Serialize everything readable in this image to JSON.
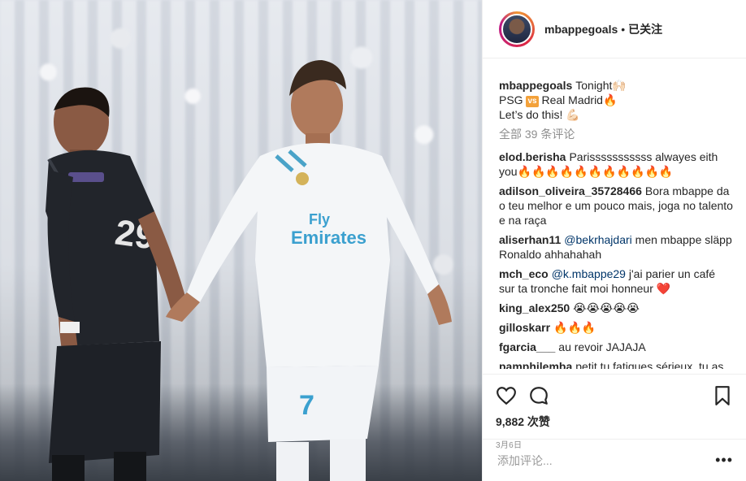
{
  "photo": {
    "alt": "Two football players holding hands on a pitch"
  },
  "header": {
    "username": "mbappegoals",
    "dot": "•",
    "follow_status": "已关注"
  },
  "caption": {
    "username": "mbappegoals",
    "line1": "Tonight🙌🏻",
    "line2_a": "PSG ",
    "vs": "vs",
    "line2_b": " Real Madrid🔥",
    "line3": "Let’s do this! 💪🏻"
  },
  "view_all": "全部 39 条评论",
  "comments": [
    {
      "user": "elod.berisha",
      "text": "Parisssssssssss alwayes eith you🔥🔥🔥🔥🔥🔥🔥🔥🔥🔥🔥"
    },
    {
      "user": "adilson_oliveira_35728466",
      "text": "Bora mbappe da o teu melhor e um pouco mais, joga no talento e na raça"
    },
    {
      "user": "aliserhan11",
      "mention": "@bekrhajdari",
      "text": " men mbappe släpp Ronaldo ahhahahah"
    },
    {
      "user": "mch_eco",
      "mention": "@k.mbappe29",
      "text": " j'ai parier un café sur ta tronche fait moi honneur ❤️"
    },
    {
      "user": "king_alex250",
      "text": "😭😭😭😭😭"
    },
    {
      "user": "gilloskarr",
      "text": "🔥🔥🔥"
    },
    {
      "user": "fgarcia___",
      "text": "au revoir JAJAJA"
    },
    {
      "user": "pamphilemba",
      "text": "petit tu fatigues sérieux, tu as"
    }
  ],
  "actions": {
    "like_icon": "heart-icon",
    "comment_icon": "comment-icon",
    "save_icon": "bookmark-icon",
    "views": "9,882 次赞",
    "date": "3月6日"
  },
  "add_comment": {
    "placeholder": "添加评论...",
    "more": "•••"
  }
}
